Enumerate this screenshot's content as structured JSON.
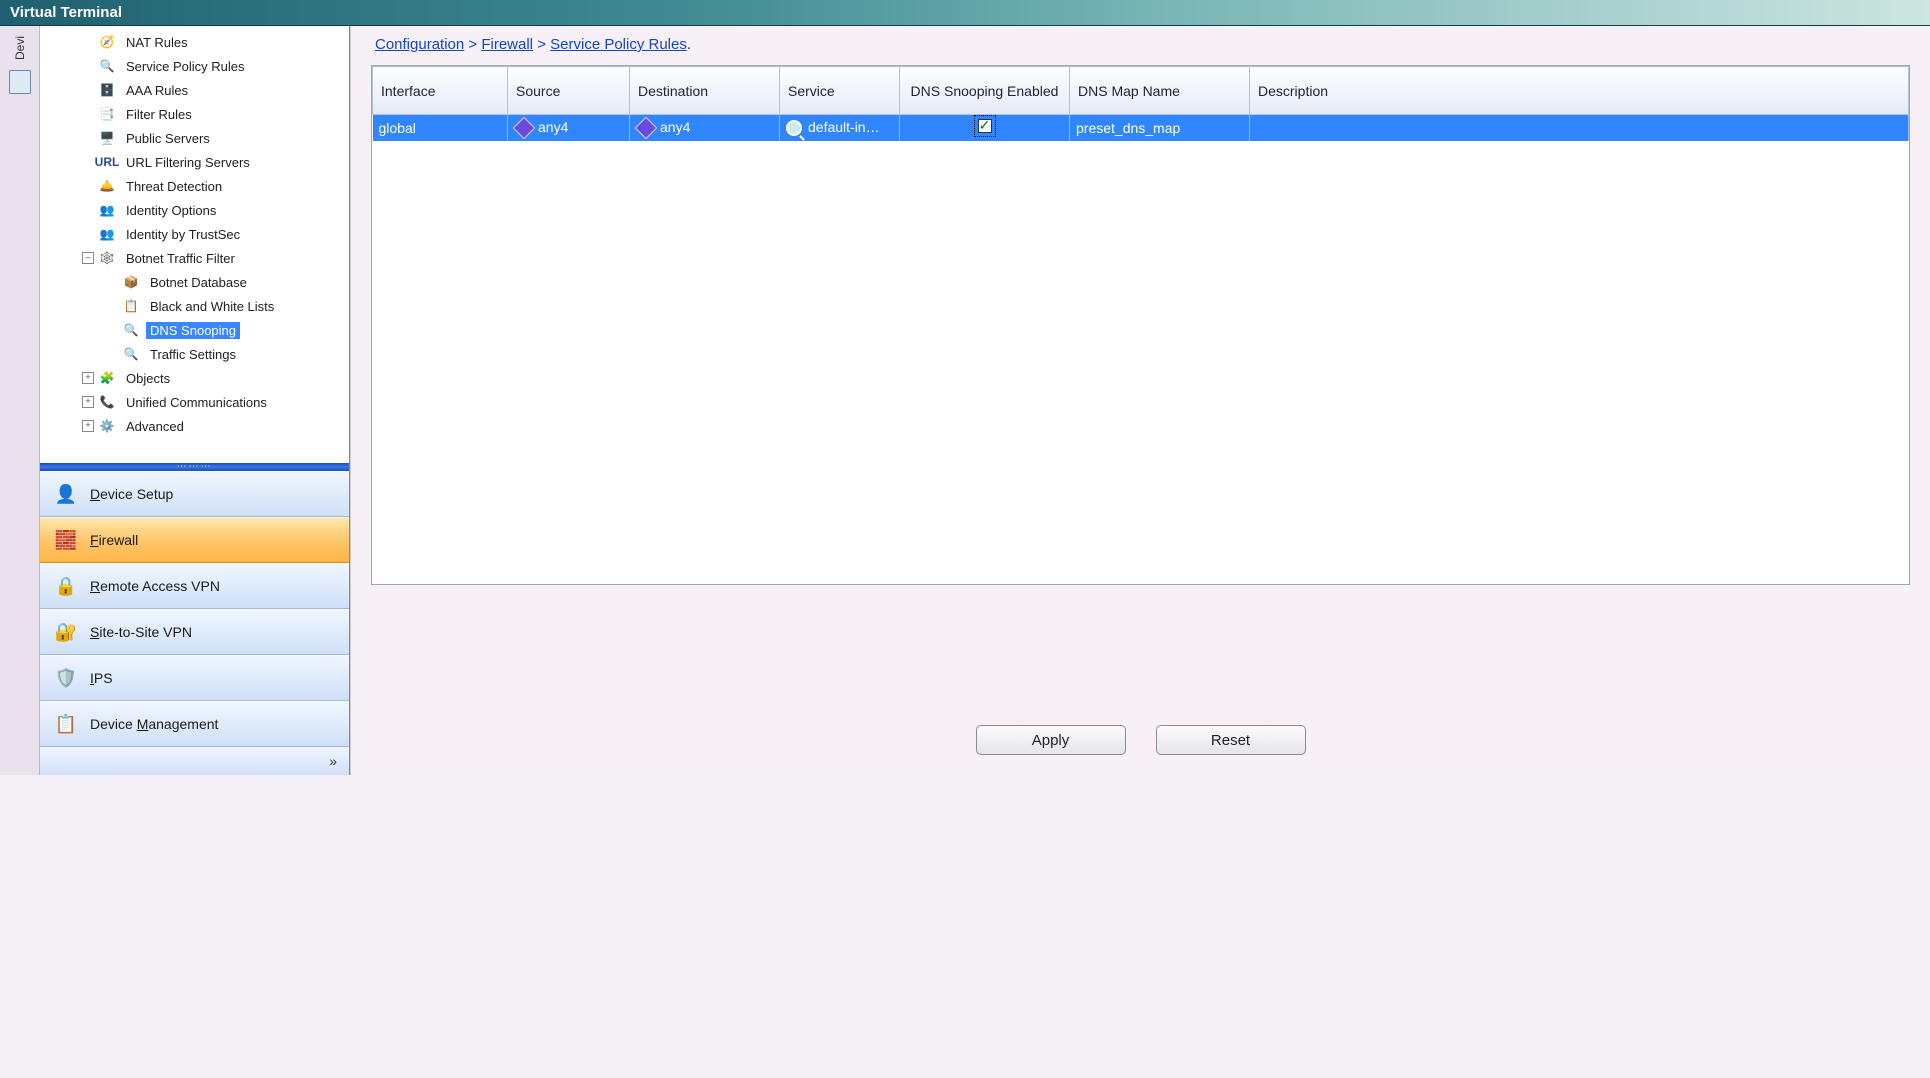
{
  "window": {
    "title": "Virtual Terminal"
  },
  "leftstub": {
    "label": "Devi"
  },
  "tree": {
    "items": [
      {
        "label": "NAT Rules",
        "indent": "ind1",
        "toggle": "",
        "iconClass": "ic-nat",
        "iconGlyph": "🧭"
      },
      {
        "label": "Service Policy Rules",
        "indent": "ind1",
        "toggle": "",
        "iconClass": "ic-magnify",
        "iconGlyph": "🔍"
      },
      {
        "label": "AAA Rules",
        "indent": "ind1",
        "toggle": "",
        "iconClass": "ic-server",
        "iconGlyph": "🗄️"
      },
      {
        "label": "Filter Rules",
        "indent": "ind1",
        "toggle": "",
        "iconClass": "ic-filter",
        "iconGlyph": "📑"
      },
      {
        "label": "Public Servers",
        "indent": "ind1",
        "toggle": "",
        "iconClass": "ic-server",
        "iconGlyph": "🖥️"
      },
      {
        "label": "URL Filtering Servers",
        "indent": "ind1",
        "toggle": "",
        "iconClass": "ic-url",
        "iconGlyph": "URL"
      },
      {
        "label": "Threat Detection",
        "indent": "ind1",
        "toggle": "",
        "iconClass": "ic-shield",
        "iconGlyph": "🛎️"
      },
      {
        "label": "Identity Options",
        "indent": "ind1",
        "toggle": "",
        "iconClass": "ic-user",
        "iconGlyph": "👥"
      },
      {
        "label": "Identity by TrustSec",
        "indent": "ind1",
        "toggle": "",
        "iconClass": "ic-user",
        "iconGlyph": "👥"
      },
      {
        "label": "Botnet Traffic Filter",
        "indent": "ind1",
        "toggle": "–",
        "iconClass": "ic-botnet",
        "iconGlyph": "🕸️"
      },
      {
        "label": "Botnet Database",
        "indent": "ind2",
        "toggle": "",
        "iconClass": "ic-db",
        "iconGlyph": "📦"
      },
      {
        "label": "Black and White Lists",
        "indent": "ind2",
        "toggle": "",
        "iconClass": "ic-list",
        "iconGlyph": "📋"
      },
      {
        "label": "DNS Snooping",
        "indent": "ind2",
        "toggle": "",
        "iconClass": "ic-magnify",
        "iconGlyph": "🔍",
        "selected": "selected"
      },
      {
        "label": "Traffic Settings",
        "indent": "ind2",
        "toggle": "",
        "iconClass": "ic-magnify",
        "iconGlyph": "🔍"
      },
      {
        "label": "Objects",
        "indent": "ind1",
        "toggle": "+",
        "iconClass": "ic-objects",
        "iconGlyph": "🧩"
      },
      {
        "label": "Unified Communications",
        "indent": "ind1",
        "toggle": "+",
        "iconClass": "ic-comm",
        "iconGlyph": "📞"
      },
      {
        "label": "Advanced",
        "indent": "ind1",
        "toggle": "+",
        "iconClass": "ic-adv",
        "iconGlyph": "⚙️"
      }
    ]
  },
  "nav": {
    "items": [
      {
        "label": "Device Setup",
        "iconClass": "ni-device",
        "active": "",
        "ukey": "D"
      },
      {
        "label": "Firewall",
        "iconClass": "ni-firewall",
        "active": "active",
        "ukey": "F"
      },
      {
        "label": "Remote Access VPN",
        "iconClass": "ni-ravpn",
        "active": "",
        "ukey": "R"
      },
      {
        "label": "Site-to-Site VPN",
        "iconClass": "ni-s2svpn",
        "active": "",
        "ukey": "S"
      },
      {
        "label": "IPS",
        "iconClass": "ni-ips",
        "active": "",
        "ukey": "I"
      },
      {
        "label": "Device Management",
        "iconClass": "ni-devicemgmt",
        "active": "",
        "ukey": "M"
      }
    ],
    "expander": "»"
  },
  "breadcrumb": {
    "segments": [
      "Configuration",
      "Firewall",
      "Service Policy Rules"
    ],
    "sep": ">",
    "trail": "."
  },
  "table": {
    "headers": {
      "interface": "Interface",
      "source": "Source",
      "destination": "Destination",
      "service": "Service",
      "dnssnoop": "DNS Snooping Enabled",
      "dnsmap": "DNS Map Name",
      "description": "Description"
    },
    "row": {
      "interface": "global",
      "source": "any4",
      "destination": "any4",
      "service": "default-in…",
      "dnssnoop_checked": "true",
      "dnsmap": "preset_dns_map",
      "description": ""
    }
  },
  "buttons": {
    "apply": "Apply",
    "reset": "Reset"
  }
}
